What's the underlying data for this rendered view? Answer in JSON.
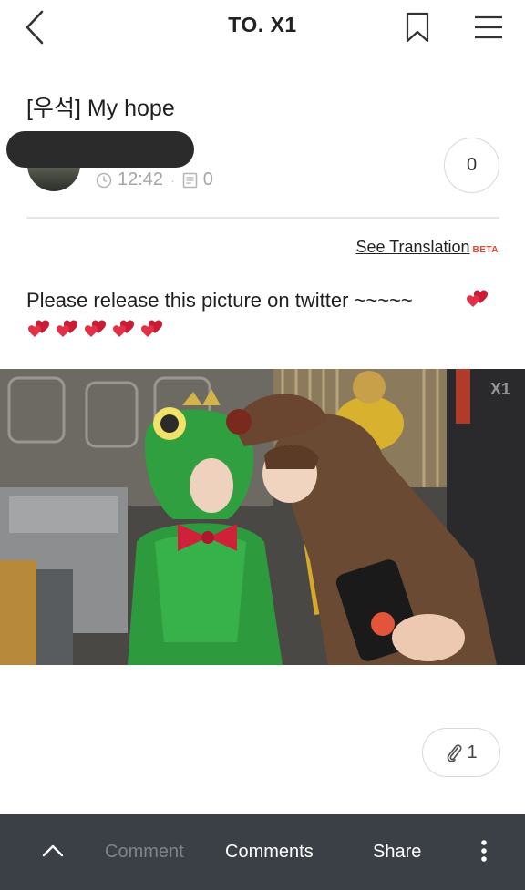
{
  "header": {
    "title": "TO. X1",
    "icons": [
      "back-arrow-icon",
      "bookmark-icon",
      "hamburger-menu-icon"
    ]
  },
  "post": {
    "title": "[우석] My hope",
    "time": "12:42",
    "comment_count": "0",
    "like_count": "0",
    "translate_label": "See Translation",
    "translate_badge": "BETA",
    "body": "Please release this picture on twitter ~~~~~",
    "hearts_count": 6,
    "photo_watermark": "X1",
    "attachment_count": "1"
  },
  "bottom_bar": {
    "comment_label": "Comment",
    "comments_label": "Comments",
    "share_label": "Share"
  },
  "colors": {
    "bottom_bar_bg": "#3b3f46",
    "heart": "#d9263b",
    "beta": "#e6462e"
  }
}
